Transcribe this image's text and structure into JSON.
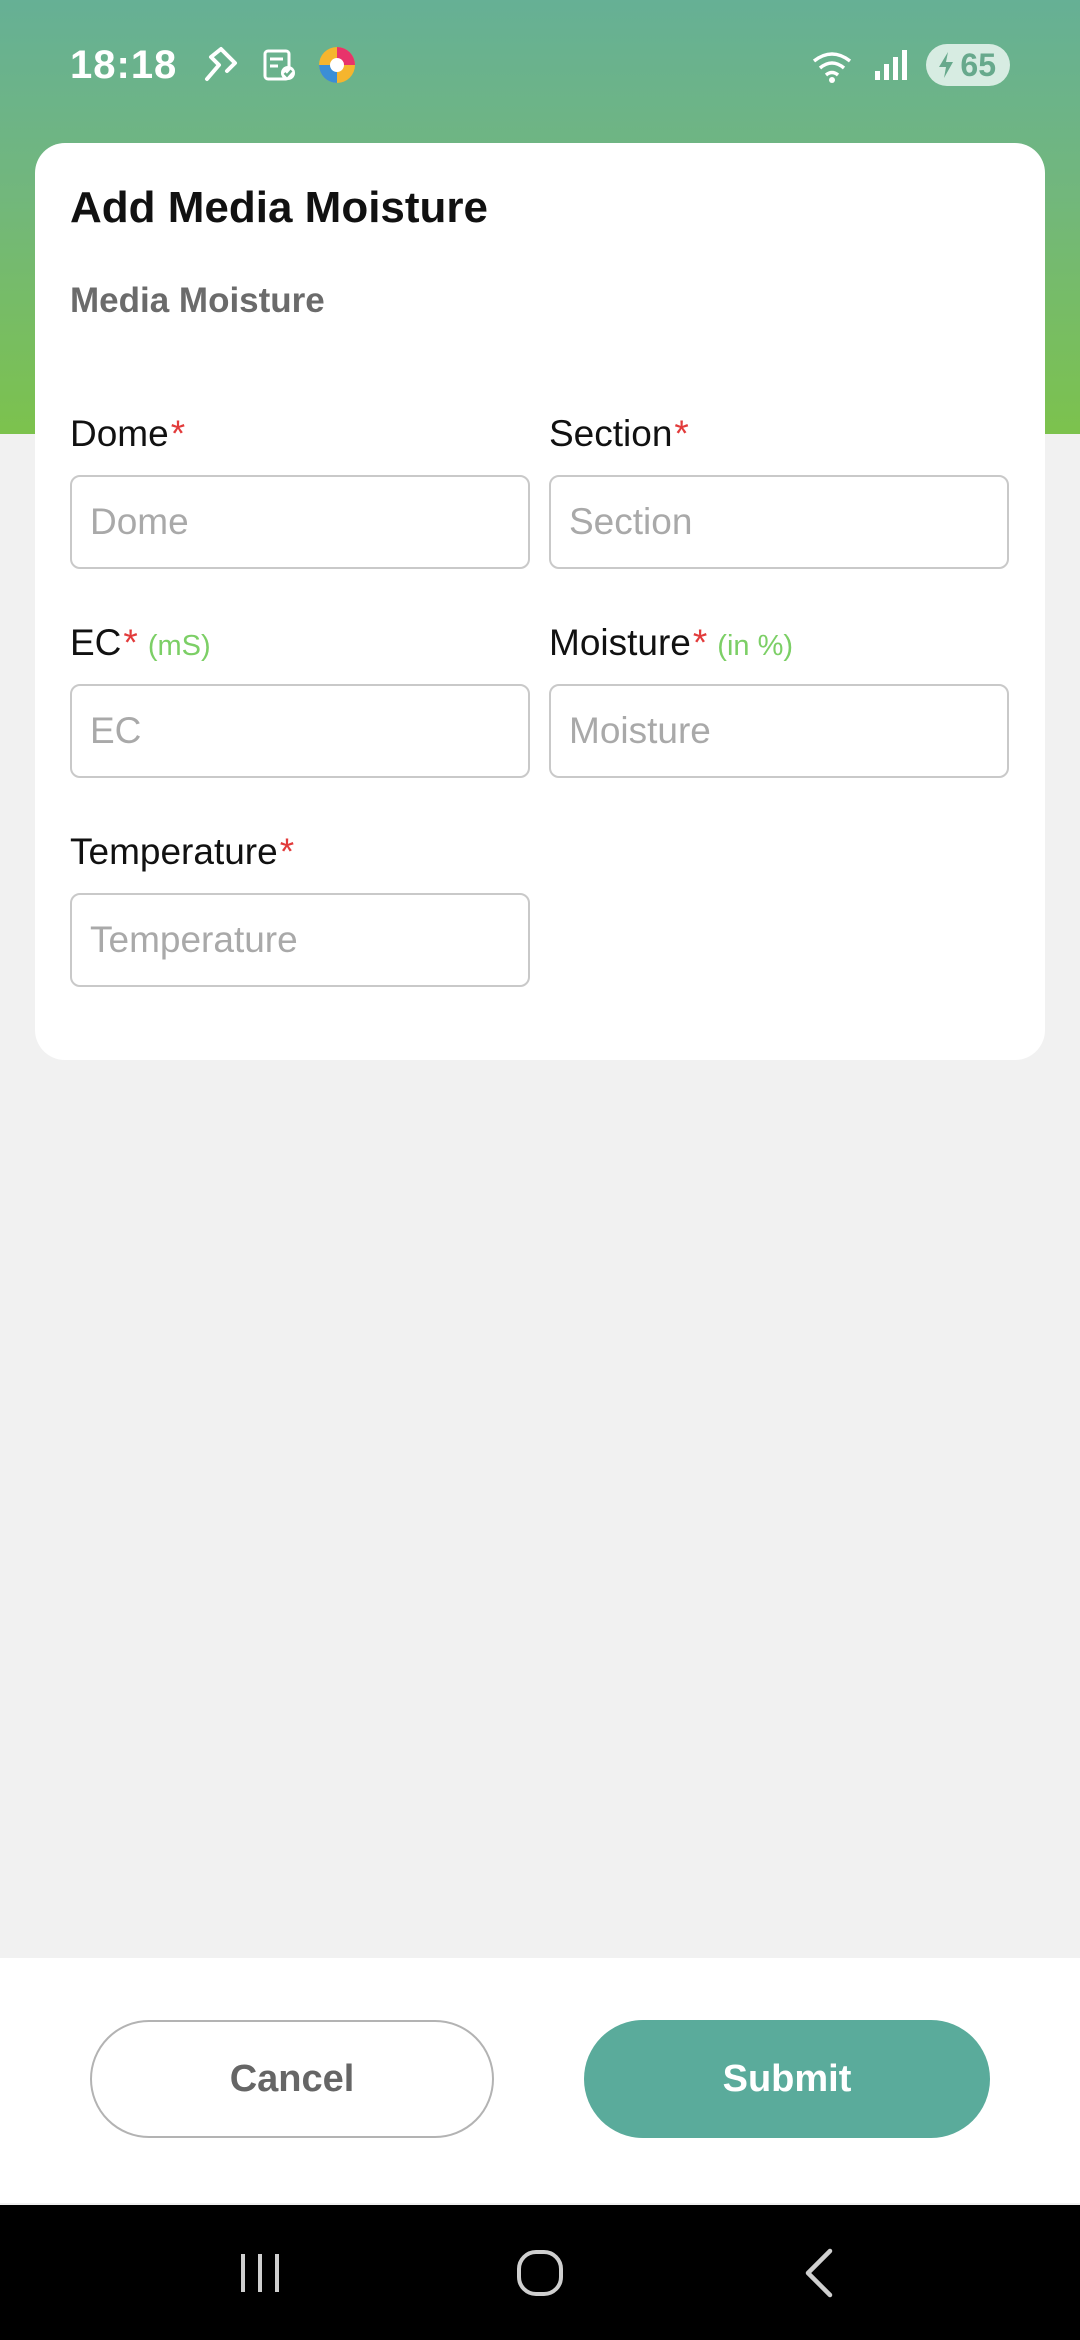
{
  "status_bar": {
    "time": "18:18",
    "battery_level": "65",
    "icons": [
      "route-icon",
      "clipboard-check-icon",
      "app-logo-icon",
      "wifi-icon",
      "signal-icon",
      "battery-charging-icon"
    ]
  },
  "colors": {
    "header_top": "#66b095",
    "header_bottom": "#7cc24d",
    "required": "#e23b3b",
    "unit": "#7ccf66",
    "submit": "#5aab9b"
  },
  "card": {
    "title": "Add Media Moisture",
    "subtitle": "Media Moisture"
  },
  "fields": {
    "dome": {
      "label": "Dome",
      "required": "*",
      "placeholder": "Dome",
      "value": ""
    },
    "section": {
      "label": "Section",
      "required": "*",
      "placeholder": "Section",
      "value": ""
    },
    "ec": {
      "label": "EC",
      "required": "*",
      "unit": "(mS)",
      "placeholder": "EC",
      "value": ""
    },
    "moisture": {
      "label": "Moisture",
      "required": "*",
      "unit": "(in %)",
      "placeholder": "Moisture",
      "value": ""
    },
    "temperature": {
      "label": "Temperature",
      "required": "*",
      "placeholder": "Temperature",
      "value": ""
    }
  },
  "actions": {
    "cancel_label": "Cancel",
    "submit_label": "Submit"
  },
  "nav": {
    "icons": [
      "recent-apps-icon",
      "home-icon",
      "back-icon"
    ]
  }
}
